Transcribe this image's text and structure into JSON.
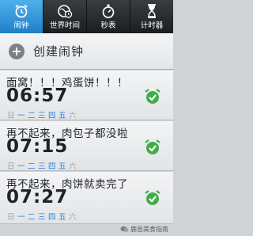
{
  "tabs": [
    {
      "label": "闹钟",
      "icon": "alarm-clock-icon",
      "active": true
    },
    {
      "label": "世界时间",
      "icon": "globe-clock-icon",
      "active": false
    },
    {
      "label": "秒表",
      "icon": "stopwatch-icon",
      "active": false
    },
    {
      "label": "计时器",
      "icon": "hourglass-icon",
      "active": false
    }
  ],
  "create": {
    "label": "创建闹钟",
    "icon": "plus-icon"
  },
  "alarms": [
    {
      "name": "面窝！！！鸡蛋饼！！！",
      "time": "06:57",
      "days": [
        "日",
        "一",
        "二",
        "三",
        "四",
        "五",
        "六"
      ],
      "days_on": [
        false,
        true,
        true,
        true,
        true,
        true,
        false
      ],
      "enabled": true
    },
    {
      "name": "再不起来，肉包子都没啦",
      "time": "07:15",
      "days": [
        "日",
        "一",
        "二",
        "三",
        "四",
        "五",
        "六"
      ],
      "days_on": [
        false,
        true,
        true,
        true,
        true,
        true,
        false
      ],
      "enabled": true
    },
    {
      "name": "再不起来，肉饼就卖完了",
      "time": "07:27",
      "days": [
        "日",
        "一",
        "二",
        "三",
        "四",
        "五",
        "六"
      ],
      "days_on": [
        false,
        true,
        true,
        true,
        true,
        true,
        false
      ],
      "enabled": true
    }
  ],
  "watermark": {
    "text": "鹿邑美食指南"
  },
  "colors": {
    "accent": "#2a7fe0",
    "check": "#34a853",
    "tab_active": "#2b8fd8"
  }
}
